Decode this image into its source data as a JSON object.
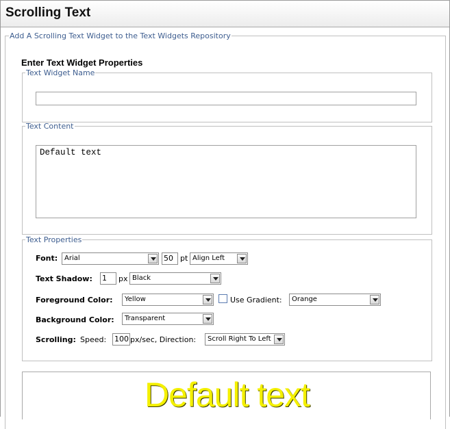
{
  "window": {
    "title": "Scrolling Text"
  },
  "section": {
    "legend": "Add A Scrolling Text Widget to the Text Widgets Repository"
  },
  "properties": {
    "heading": "Enter Text Widget Properties"
  },
  "widget_name": {
    "legend": "Text Widget Name",
    "value": ""
  },
  "text_content": {
    "legend": "Text Content",
    "value": "Default text"
  },
  "text_properties": {
    "legend": "Text Properties",
    "font": {
      "label": "Font:",
      "value": "Arial",
      "size": "50",
      "size_unit": "pt",
      "align": "Align Left"
    },
    "shadow": {
      "label": "Text Shadow:",
      "value": "1",
      "unit": "px",
      "color": "Black"
    },
    "foreground": {
      "label": "Foreground Color:",
      "value": "Yellow",
      "gradient_label": "Use Gradient:",
      "gradient_checked": false,
      "gradient_value": "Orange"
    },
    "background": {
      "label": "Background Color:",
      "value": "Transparent"
    },
    "scrolling": {
      "label": "Scrolling:",
      "speed_label": "Speed:",
      "speed": "100",
      "speed_unit": "px/sec, Direction:",
      "direction": "Scroll Right To Left"
    }
  },
  "preview": {
    "text": "Default text",
    "color": "#f4f000"
  }
}
